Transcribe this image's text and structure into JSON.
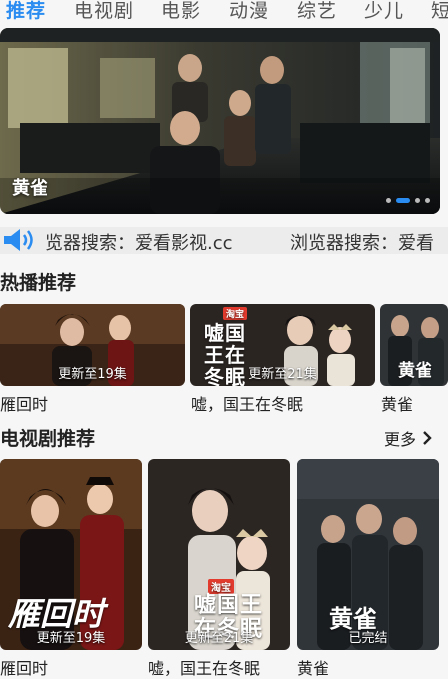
{
  "tabs": [
    {
      "label": "推荐",
      "active": true
    },
    {
      "label": "电视剧"
    },
    {
      "label": "电影"
    },
    {
      "label": "动漫"
    },
    {
      "label": "综艺"
    },
    {
      "label": "少儿"
    },
    {
      "label": "短"
    }
  ],
  "banner": {
    "title": "黄雀",
    "slide_count": 4,
    "active_slide": 1
  },
  "notice": {
    "segments": [
      "览器搜索：爱看影视.cc",
      "浏览器搜索：爱看"
    ]
  },
  "hot": {
    "title": "热播推荐",
    "items": [
      {
        "name": "雁回时",
        "badge": "更新至19集"
      },
      {
        "name": "嘘，国王在冬眠",
        "badge": "更新至21集",
        "logo": "嘘国王在冬眠",
        "tag": "淘宝"
      },
      {
        "name": "黄雀",
        "badge": "",
        "logo": "黄雀"
      }
    ]
  },
  "tv": {
    "title": "电视剧推荐",
    "more_label": "更多",
    "items": [
      {
        "name": "雁回时",
        "badge": "更新至19集",
        "logo": "雁回时"
      },
      {
        "name": "嘘，国王在冬眠",
        "badge": "更新至21集",
        "logo": "嘘国王在冬眠",
        "tag": "淘宝"
      },
      {
        "name": "黄雀",
        "badge": "已完结",
        "logo": "黄雀"
      }
    ]
  },
  "colors": {
    "accent": "#2a8cf0",
    "background": "#f6f6f6"
  }
}
